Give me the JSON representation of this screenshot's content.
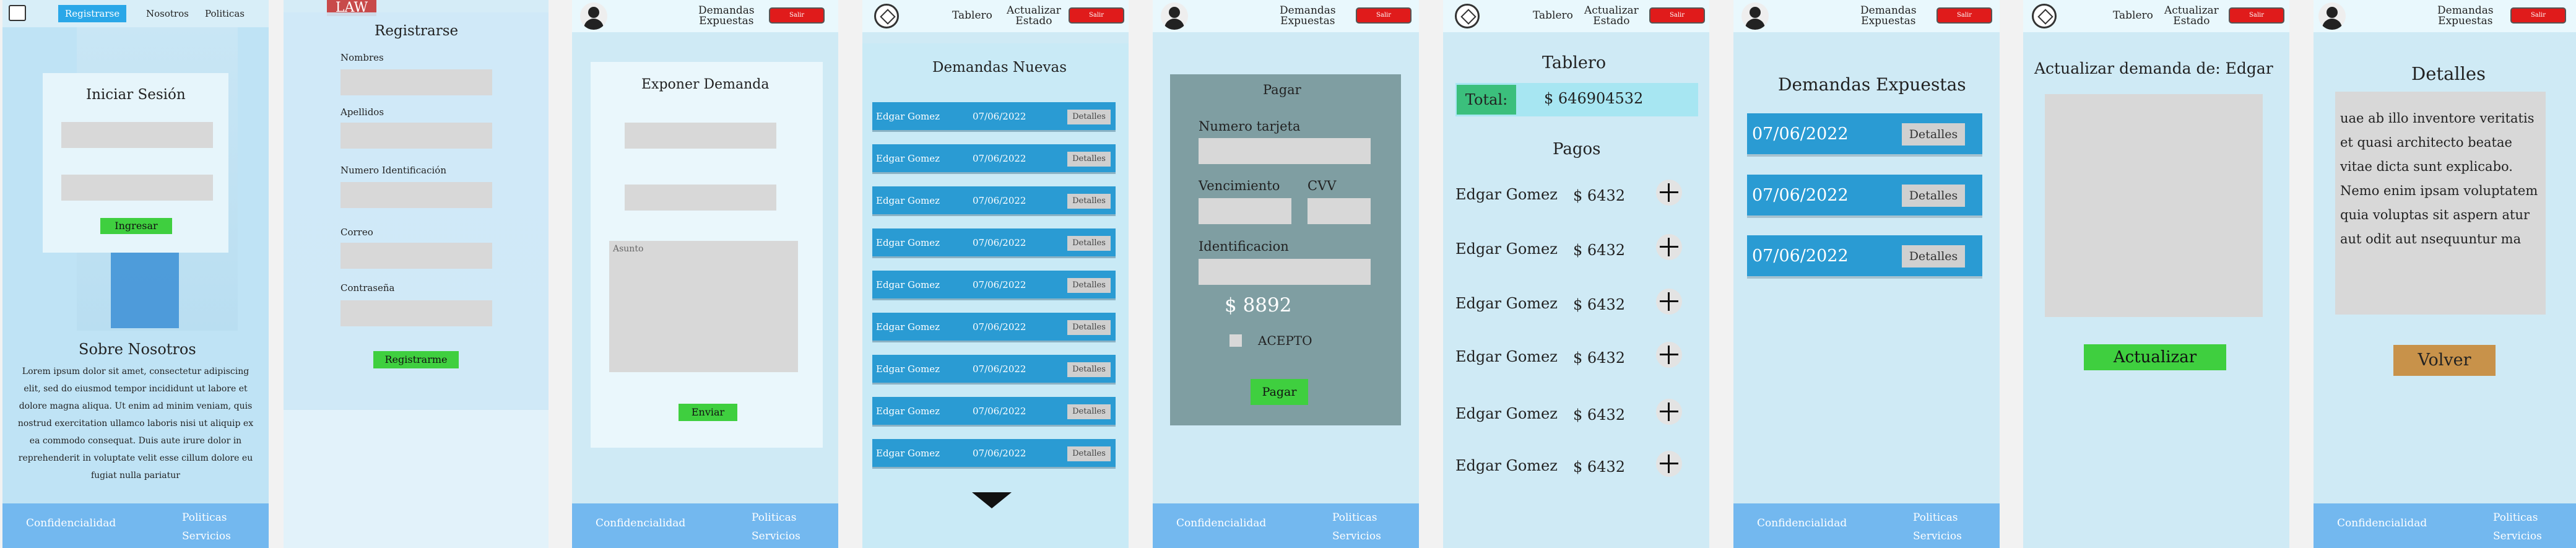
{
  "s1": {
    "nav": [
      "Registrarse",
      "Nosotros",
      "Politicas"
    ],
    "login_title": "Iniciar Sesión",
    "login_button": "Ingresar",
    "about_title": "Sobre Nosotros",
    "about_text": "Lorem ipsum dolor sit amet, consectetur adipiscing elit, sed do eiusmod tempor incididunt ut labore et dolore magna aliqua. Ut enim ad minim veniam, quis nostrud exercitation ullamco laboris nisi ut aliquip ex ea commodo consequat. Duis aute irure dolor in reprehenderit in voluptate velit esse cillum dolore eu fugiat nulla pariatur"
  },
  "s2": {
    "sign_text": "LAW",
    "title": "Registrarse",
    "fields": [
      "Nombres",
      "Apellidos",
      "Numero Identificación",
      "Correo",
      "Contraseña"
    ],
    "button": "Registrarme"
  },
  "footer": {
    "left": "Confidencialidad",
    "right1": "Politicas",
    "right2": "Servicios"
  },
  "s3": {
    "title": "Exponer Demanda",
    "textarea_placeholder": "Asunto",
    "button": "Enviar"
  },
  "nav_admin": {
    "tablero": "Tablero",
    "actualizar1": "Actualizar",
    "actualizar2": "Estado"
  },
  "nav_user": {
    "demandas1": "Demandas",
    "demandas2": "Expuestas"
  },
  "red_button": "Salir",
  "s4": {
    "title": "Demandas Nuevas",
    "rows": [
      {
        "name": "Edgar Gomez",
        "date": "07/06/2022",
        "btn": "Detalles"
      },
      {
        "name": "Edgar Gomez",
        "date": "07/06/2022",
        "btn": "Detalles"
      },
      {
        "name": "Edgar Gomez",
        "date": "07/06/2022",
        "btn": "Detalles"
      },
      {
        "name": "Edgar Gomez",
        "date": "07/06/2022",
        "btn": "Detalles"
      },
      {
        "name": "Edgar Gomez",
        "date": "07/06/2022",
        "btn": "Detalles"
      },
      {
        "name": "Edgar Gomez",
        "date": "07/06/2022",
        "btn": "Detalles"
      },
      {
        "name": "Edgar Gomez",
        "date": "07/06/2022",
        "btn": "Detalles"
      },
      {
        "name": "Edgar Gomez",
        "date": "07/06/2022",
        "btn": "Detalles"
      },
      {
        "name": "Edgar Gomez",
        "date": "07/06/2022",
        "btn": "Detalles"
      }
    ]
  },
  "s5": {
    "title": "Pagar",
    "card_label": "Numero tarjeta",
    "exp_label": "Vencimiento",
    "cvv_label": "CVV",
    "id_label": "Identificacion",
    "amount": "$ 8892",
    "accept_label": "ACEPTO",
    "button": "Pagar"
  },
  "s6": {
    "title": "Tablero",
    "total_label": "Total:",
    "total_value": "$ 646904532",
    "payments_title": "Pagos",
    "payments": [
      {
        "name": "Edgar Gomez",
        "amount": "$ 6432"
      },
      {
        "name": "Edgar Gomez",
        "amount": "$ 6432"
      },
      {
        "name": "Edgar Gomez",
        "amount": "$ 6432"
      },
      {
        "name": "Edgar Gomez",
        "amount": "$ 6432"
      },
      {
        "name": "Edgar Gomez",
        "amount": "$ 6432"
      },
      {
        "name": "Edgar Gomez",
        "amount": "$ 6432"
      }
    ]
  },
  "s7": {
    "title": "Demandas Expuestas",
    "rows": [
      {
        "date": "07/06/2022",
        "btn": "Detalles"
      },
      {
        "date": "07/06/2022",
        "btn": "Detalles"
      },
      {
        "date": "07/06/2022",
        "btn": "Detalles"
      }
    ]
  },
  "s8": {
    "title": "Actualizar demanda de: Edgar",
    "button": "Actualizar"
  },
  "s9": {
    "title": "Detalles",
    "text": "uae ab illo inventore veritatis et quasi architecto beatae vitae dicta sunt explicabo. Nemo enim ipsam voluptatem quia voluptas sit aspern atur aut odit aut nsequuntur ma",
    "button": "Volver"
  },
  "colors": {
    "accent_blue": "#2a9bd3",
    "green": "#3fcf3f",
    "footer": "#73b8ef",
    "salir_red": "#e01b1b",
    "volver": "#c8924a"
  }
}
